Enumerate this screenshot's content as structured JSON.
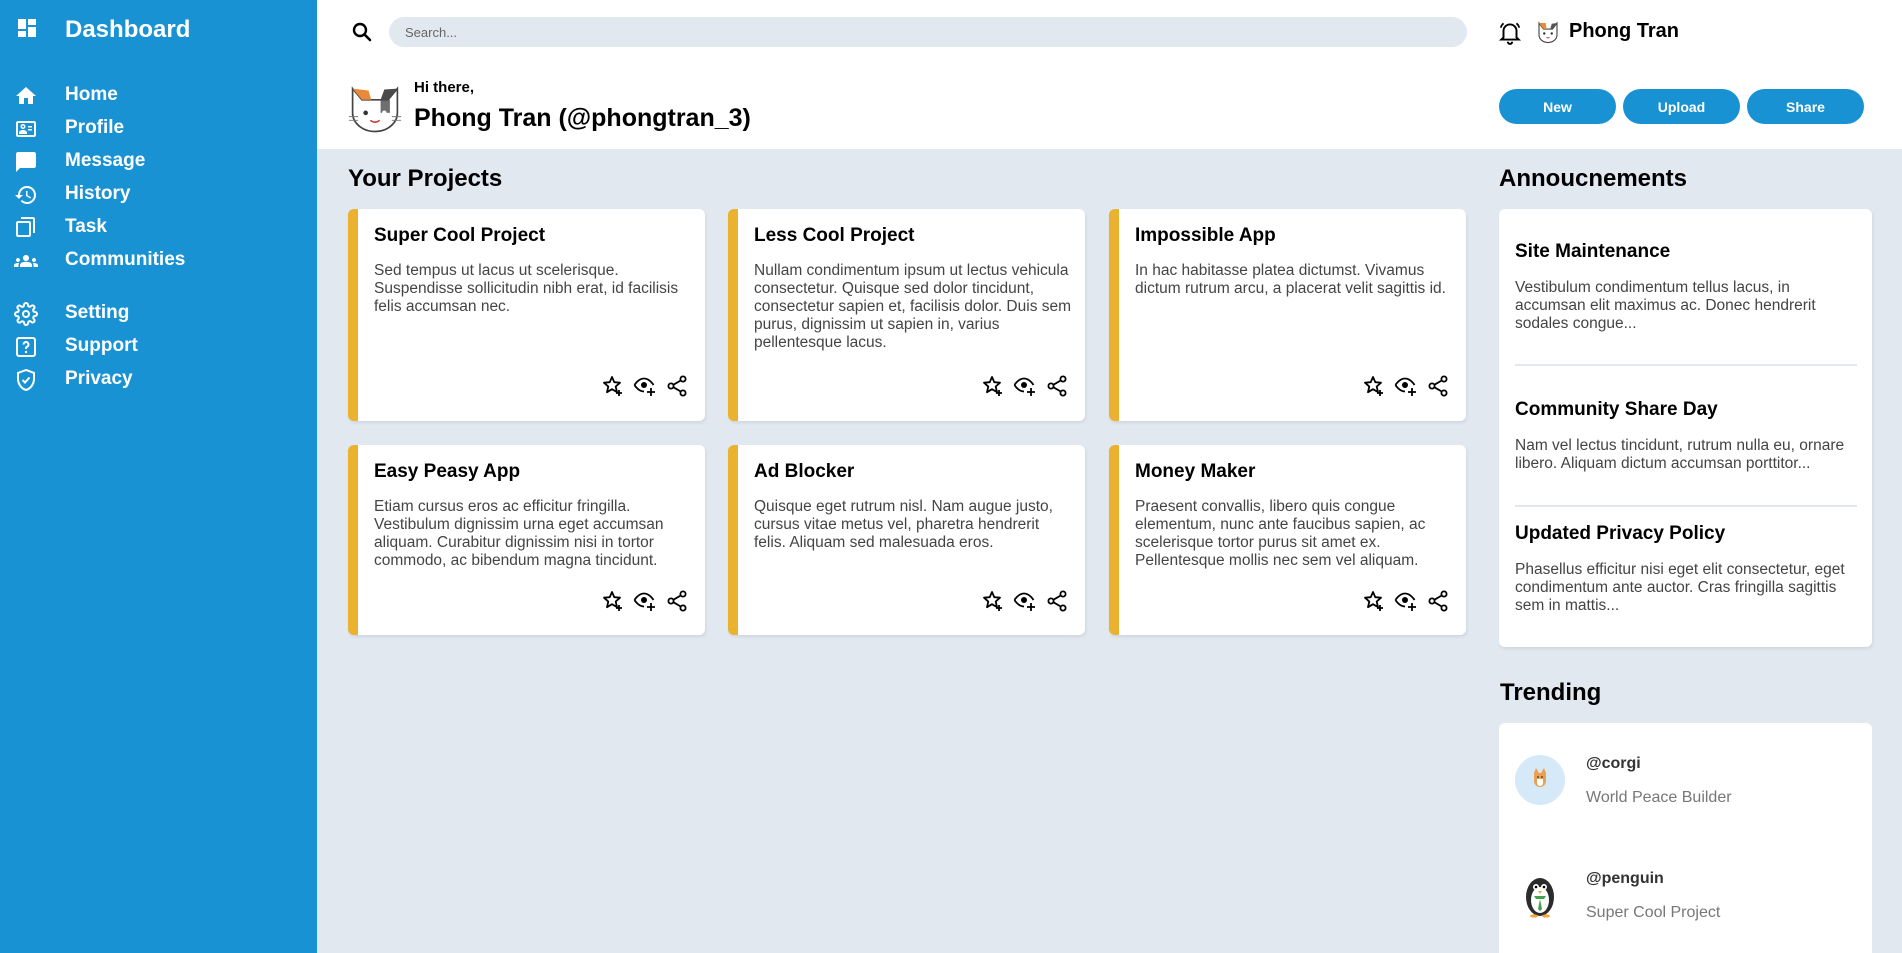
{
  "sidebar": {
    "title": "Dashboard",
    "items": [
      {
        "label": "Home",
        "icon": "home-icon"
      },
      {
        "label": "Profile",
        "icon": "profile-icon"
      },
      {
        "label": "Message",
        "icon": "message-icon"
      },
      {
        "label": "History",
        "icon": "history-icon"
      },
      {
        "label": "Task",
        "icon": "task-icon"
      },
      {
        "label": "Communities",
        "icon": "communities-icon"
      }
    ],
    "items2": [
      {
        "label": "Setting",
        "icon": "gear-icon"
      },
      {
        "label": "Support",
        "icon": "support-icon"
      },
      {
        "label": "Privacy",
        "icon": "shield-icon"
      }
    ]
  },
  "header": {
    "search_placeholder": "Search...",
    "user_name": "Phong Tran",
    "greeting": "Hi there,",
    "greeting_name": "Phong Tran (@phongtran_3)",
    "buttons": {
      "new": "New",
      "upload": "Upload",
      "share": "Share"
    }
  },
  "projects": {
    "title": "Your Projects",
    "cards": [
      {
        "title": "Super Cool Project",
        "desc": "Sed tempus ut lacus ut scelerisque. Suspendisse sollicitudin nibh erat, id facilisis felis accumsan nec."
      },
      {
        "title": "Less Cool Project",
        "desc": "Nullam condimentum ipsum ut lectus vehicula consectetur. Quisque sed dolor tincidunt, consectetur sapien et, facilisis dolor. Duis sem purus, dignissim ut sapien in, varius pellentesque lacus."
      },
      {
        "title": "Impossible App",
        "desc": "In hac habitasse platea dictumst. Vivamus dictum rutrum arcu, a placerat velit sagittis id."
      },
      {
        "title": "Easy Peasy App",
        "desc": "Etiam cursus eros ac efficitur fringilla. Vestibulum dignissim urna eget accumsan aliquam. Curabitur dignissim nisi in tortor commodo, ac bibendum magna tincidunt."
      },
      {
        "title": "Ad Blocker",
        "desc": "Quisque eget rutrum nisl. Nam augue justo, cursus vitae metus vel, pharetra hendrerit felis. Aliquam sed malesuada eros."
      },
      {
        "title": "Money Maker",
        "desc": "Praesent convallis, libero quis congue elementum, nunc ante faucibus sapien, ac scelerisque tortor purus sit amet ex. Pellentesque mollis nec sem vel aliquam."
      }
    ]
  },
  "announcements": {
    "title": "Annoucnements",
    "items": [
      {
        "title": "Site Maintenance",
        "desc": "Vestibulum condimentum tellus lacus, in accumsan elit maximus ac. Donec hendrerit sodales congue..."
      },
      {
        "title": "Community Share Day",
        "desc": "Nam vel lectus tincidunt, rutrum nulla eu, ornare libero. Aliquam dictum accumsan porttitor..."
      },
      {
        "title": "Updated Privacy Policy",
        "desc": "Phasellus efficitur nisi eget elit consectetur, eget condimentum ante auctor. Cras fringilla sagittis sem in mattis..."
      }
    ]
  },
  "trending": {
    "title": "Trending",
    "items": [
      {
        "handle": "@corgi",
        "sub": "World Peace Builder"
      },
      {
        "handle": "@penguin",
        "sub": "Super Cool Project"
      }
    ]
  },
  "colors": {
    "sidebar": "#1992d4",
    "accent": "#eab22e",
    "background": "#e2e8f0"
  }
}
